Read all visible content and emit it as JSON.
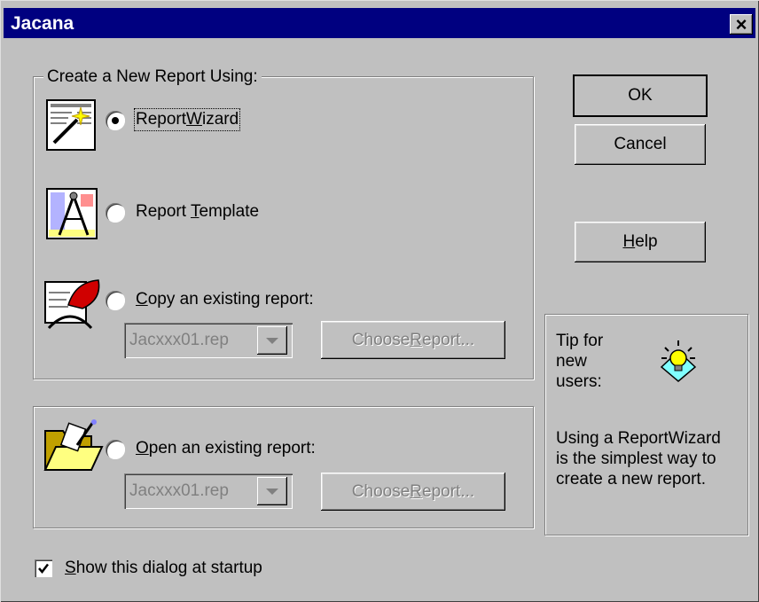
{
  "window": {
    "title": "Jacana",
    "close_glyph": "×"
  },
  "create_group": {
    "legend": "Create a New Report Using:",
    "options": [
      {
        "pre": "Report",
        "accel": "W",
        "post": "izard",
        "selected": true,
        "icon": "report-wizard-icon"
      },
      {
        "pre": "Report ",
        "accel": "T",
        "post": "emplate",
        "selected": false,
        "icon": "report-template-icon"
      },
      {
        "pre": "",
        "accel": "C",
        "post": "opy an existing report:",
        "selected": false,
        "icon": "copy-report-icon"
      }
    ],
    "copy_combo_value": "Jacxxx01.rep",
    "copy_choose": {
      "pre": "Choose ",
      "accel": "R",
      "post": "eport..."
    }
  },
  "open_group": {
    "option": {
      "pre": "",
      "accel": "O",
      "post": "pen an existing report:",
      "selected": false,
      "icon": "open-folder-icon"
    },
    "combo_value": "Jacxxx01.rep",
    "choose": {
      "pre": "Choose ",
      "accel": "R",
      "post": "eport..."
    }
  },
  "buttons": {
    "ok": "OK",
    "cancel": "Cancel",
    "help": {
      "pre": "",
      "accel": "H",
      "post": "elp"
    }
  },
  "tip": {
    "heading_lines": [
      "Tip for",
      "new",
      "users:"
    ],
    "body_lines": [
      "Using a ReportWizard",
      "is the simplest way to",
      "create a new report."
    ],
    "icon": "lightbulb-icon"
  },
  "startup": {
    "checked": true,
    "pre": "",
    "accel": "S",
    "post": "how this dialog at startup"
  },
  "colors": {
    "titlebar": "#000080",
    "face": "#c0c0c0"
  }
}
